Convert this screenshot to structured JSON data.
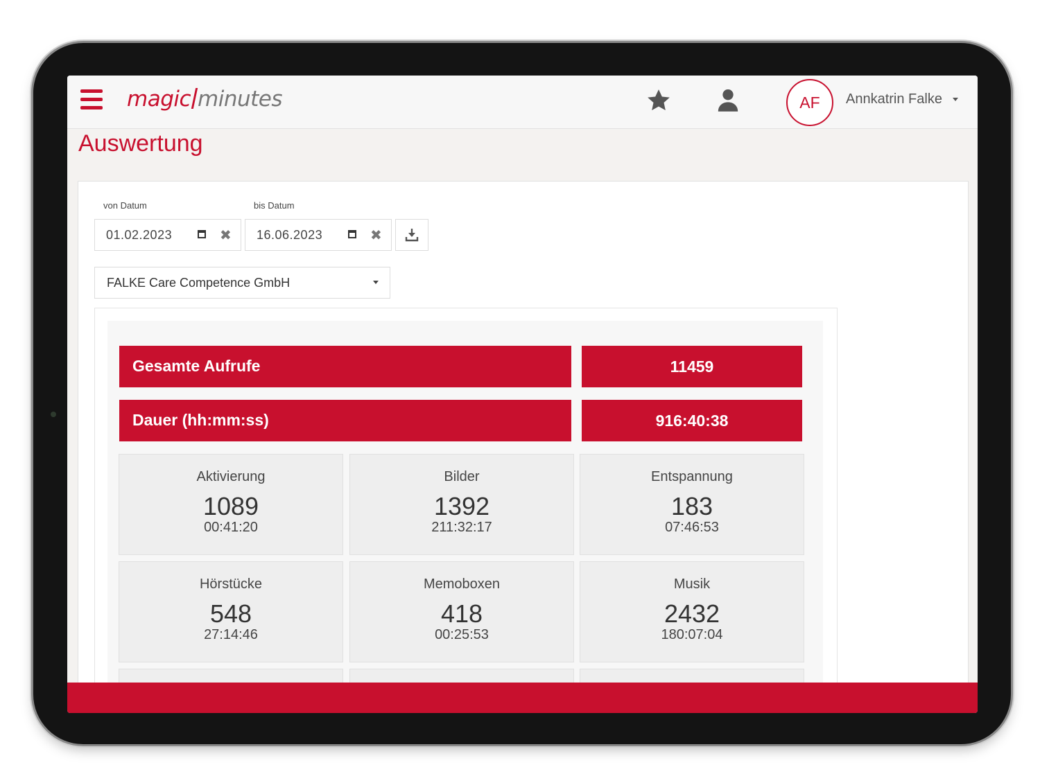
{
  "app": {
    "logo_part1": "magic",
    "logo_part2": "minutes"
  },
  "navbar": {
    "favorites_icon": "star-icon",
    "profile_icon": "user-icon",
    "avatar_initials": "AF",
    "user_name": "Annkatrin Falke"
  },
  "page": {
    "title": "Auswertung"
  },
  "filters": {
    "from_label": "von Datum",
    "from_value": "01.02.2023",
    "to_label": "bis Datum",
    "to_value": "16.06.2023",
    "organization": "FALKE Care Competence GmbH"
  },
  "totals": {
    "calls_label": "Gesamte Aufrufe",
    "calls_value": "11459",
    "duration_label": "Dauer (hh:mm:ss)",
    "duration_value": "916:40:38"
  },
  "categories": [
    {
      "name": "Aktivierung",
      "count": "1089",
      "duration": "00:41:20"
    },
    {
      "name": "Bilder",
      "count": "1392",
      "duration": "211:32:17"
    },
    {
      "name": "Entspannung",
      "count": "183",
      "duration": "07:46:53"
    },
    {
      "name": "Hörstücke",
      "count": "548",
      "duration": "27:14:46"
    },
    {
      "name": "Memoboxen",
      "count": "418",
      "duration": "00:25:53"
    },
    {
      "name": "Musik",
      "count": "2432",
      "duration": "180:07:04"
    }
  ],
  "colors": {
    "brand_red": "#c8102e"
  }
}
